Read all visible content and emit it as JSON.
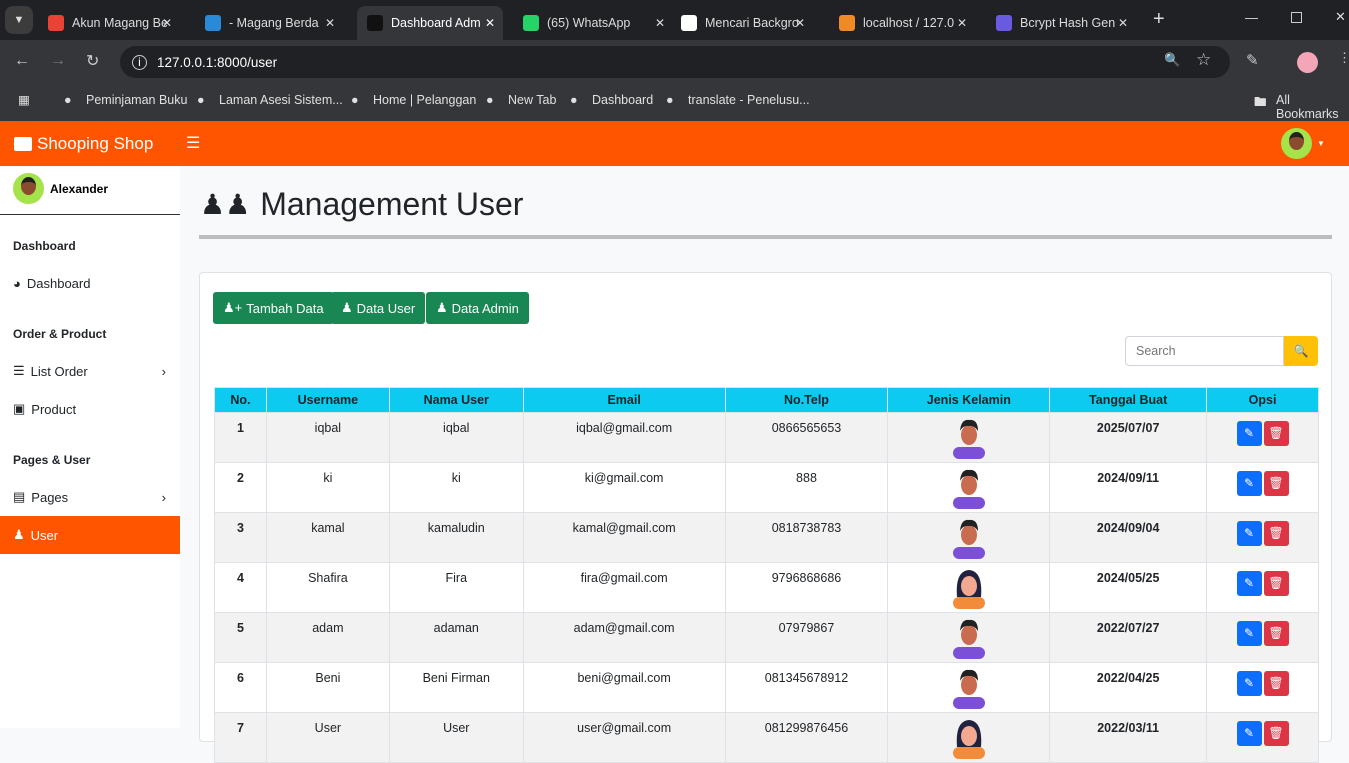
{
  "browser": {
    "tabs": [
      {
        "label": "Akun Magang Be",
        "color": "#ea4335"
      },
      {
        "label": "- Magang Berda",
        "color": "#2b8ad8"
      },
      {
        "label": "Dashboard Adm",
        "color": "#111111",
        "active": true
      },
      {
        "label": "(65) WhatsApp",
        "color": "#25d366"
      },
      {
        "label": "Mencari Backgro",
        "color": "#ffffff"
      },
      {
        "label": "localhost / 127.0",
        "color": "#f08a24"
      },
      {
        "label": "Bcrypt Hash Gen",
        "color": "#6a5ae0"
      }
    ],
    "url": "127.0.0.1:8000/user",
    "bookmarks": [
      "Peminjaman Buku",
      "Laman Asesi Sistem...",
      "Home | Pelanggan",
      "New Tab",
      "Dashboard",
      "translate - Penelusu...",
      "All Bookmarks"
    ]
  },
  "navbar": {
    "brand": "Shooping Shop"
  },
  "sidebar": {
    "user": "Alexander",
    "sections": [
      "Dashboard",
      "Order & Product",
      "Pages & User"
    ],
    "items": [
      "Dashboard",
      "List Order",
      "Product",
      "Pages",
      "User"
    ],
    "active": "User"
  },
  "page": {
    "title": "Management User",
    "buttons": [
      "Tambah Data",
      "Data User",
      "Data Admin"
    ],
    "search_placeholder": "Search",
    "columns": [
      "No.",
      "Username",
      "Nama User",
      "Email",
      "No.Telp",
      "Jenis Kelamin",
      "Tanggal Buat",
      "Opsi"
    ],
    "rows": [
      {
        "no": "1",
        "username": "iqbal",
        "nama": "iqbal",
        "email": "iqbal@gmail.com",
        "telp": "0866565653",
        "gender": "male",
        "tanggal": "2025/07/07"
      },
      {
        "no": "2",
        "username": "ki",
        "nama": "ki",
        "email": "ki@gmail.com",
        "telp": "888",
        "gender": "male",
        "tanggal": "2024/09/11"
      },
      {
        "no": "3",
        "username": "kamal",
        "nama": "kamaludin",
        "email": "kamal@gmail.com",
        "telp": "0818738783",
        "gender": "male",
        "tanggal": "2024/09/04"
      },
      {
        "no": "4",
        "username": "Shafira",
        "nama": "Fira",
        "email": "fira@gmail.com",
        "telp": "9796868686",
        "gender": "female",
        "tanggal": "2024/05/25"
      },
      {
        "no": "5",
        "username": "adam",
        "nama": "adaman",
        "email": "adam@gmail.com",
        "telp": "07979867",
        "gender": "male",
        "tanggal": "2022/07/27"
      },
      {
        "no": "6",
        "username": "Beni",
        "nama": "Beni Firman",
        "email": "beni@gmail.com",
        "telp": "081345678912",
        "gender": "male",
        "tanggal": "2022/04/25"
      },
      {
        "no": "7",
        "username": "User",
        "nama": "User",
        "email": "user@gmail.com",
        "telp": "081299876456",
        "gender": "female",
        "tanggal": "2022/03/11"
      }
    ]
  },
  "colors": {
    "brand": "#ff5500",
    "header": "#0dcaf0",
    "success": "#198754",
    "edit": "#0d6efd",
    "delete": "#dc3545",
    "search": "#ffc107"
  }
}
